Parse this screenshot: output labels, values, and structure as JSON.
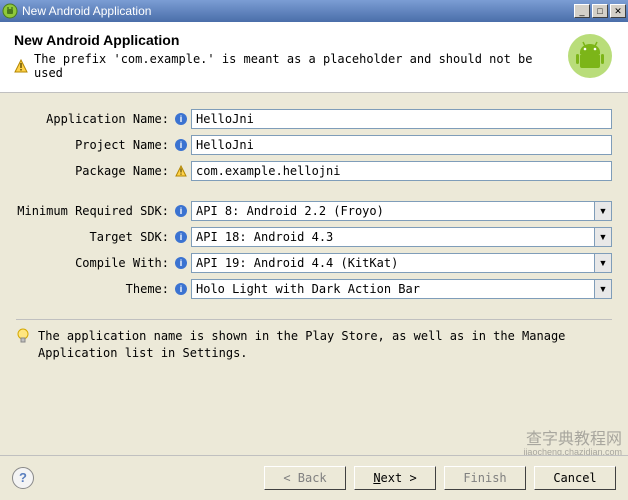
{
  "window": {
    "title": "New Android Application"
  },
  "banner": {
    "heading": "New Android Application",
    "warning": "The prefix 'com.example.' is meant as a placeholder and should not be used"
  },
  "fields": {
    "app_name_label": "Application Name:",
    "app_name_value": "HelloJni",
    "project_name_label": "Project Name:",
    "project_name_value": "HelloJni",
    "package_name_label": "Package Name:",
    "package_name_value": "com.example.hellojni",
    "min_sdk_label": "Minimum Required SDK:",
    "min_sdk_value": "API 8: Android 2.2 (Froyo)",
    "target_sdk_label": "Target SDK:",
    "target_sdk_value": "API 18: Android 4.3",
    "compile_with_label": "Compile With:",
    "compile_with_value": "API 19: Android 4.4 (KitKat)",
    "theme_label": "Theme:",
    "theme_value": "Holo Light with Dark Action Bar"
  },
  "tip": "The application name is shown in the Play Store, as well as in the Manage Application list in Settings.",
  "buttons": {
    "back": "< Back",
    "next": "Next >",
    "finish": "Finish",
    "cancel": "Cancel",
    "help": "?"
  },
  "watermark": {
    "main": "查字典教程网",
    "sub": "jiaocheng.chazidian.com"
  }
}
